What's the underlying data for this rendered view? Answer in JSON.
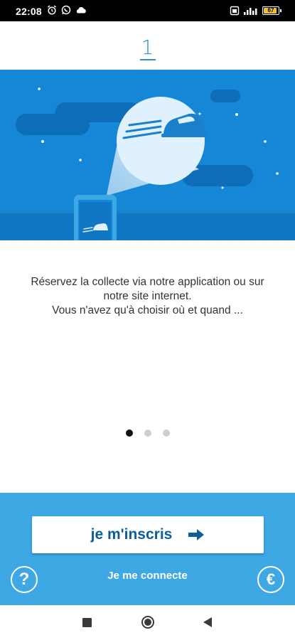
{
  "status_bar": {
    "time": "22:08",
    "battery_level": "67",
    "left_icons": [
      "alarm-icon",
      "whatsapp-icon",
      "cloud-icon"
    ],
    "right_icons": [
      "sim-icon",
      "signal-icon",
      "battery-icon"
    ]
  },
  "onboarding": {
    "step_number": "1",
    "description_lines": [
      "Réservez la collecte via notre application ou sur",
      "notre site internet.",
      "Vous n'avez qu'à choisir où et quand ..."
    ],
    "pages_total": 3,
    "current_page": 1
  },
  "actions": {
    "signup_label": "je m'inscris",
    "login_label": "Je me connecte",
    "help_label": "?",
    "pricing_label": "€"
  },
  "colors": {
    "accent": "#3ea8e5",
    "brand_dark": "#0b5e9c",
    "sky": "#1587d6"
  }
}
